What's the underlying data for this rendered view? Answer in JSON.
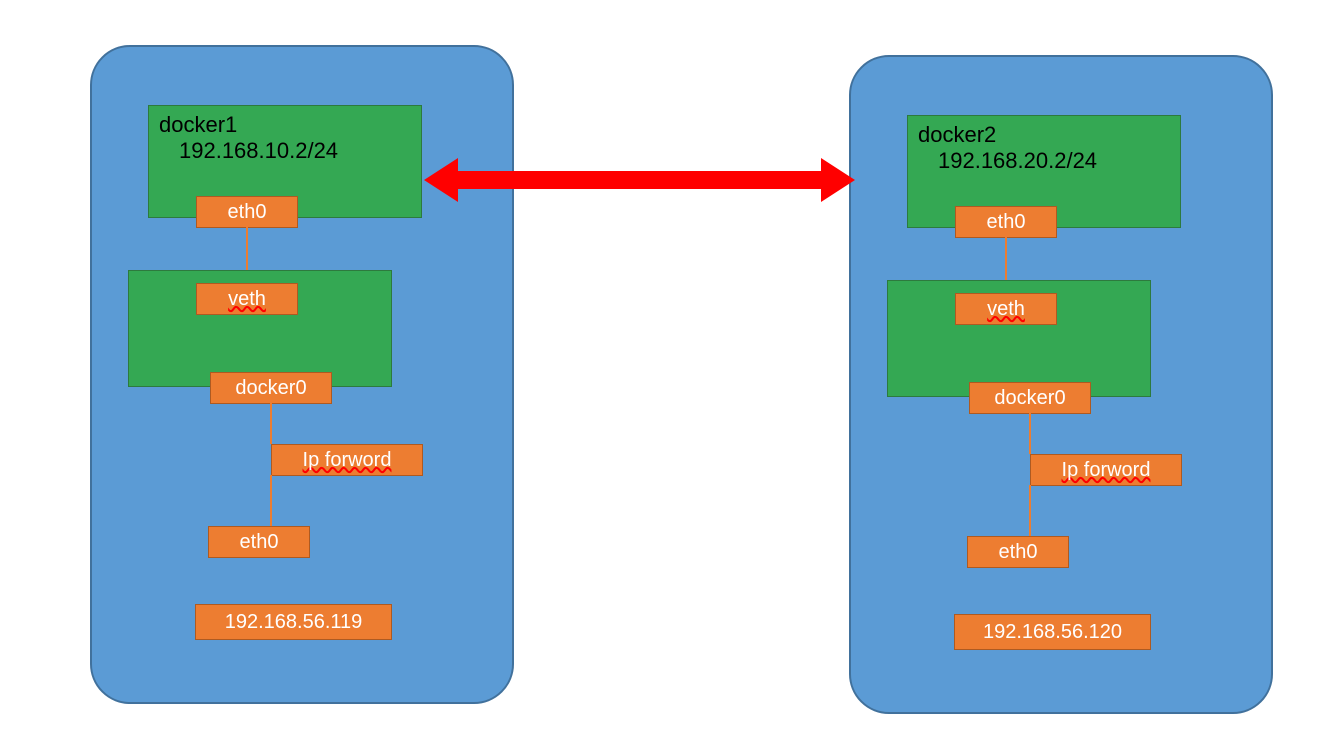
{
  "host1": {
    "docker_name": "docker1",
    "docker_ip": "192.168.10.2/24",
    "eth0_top": "eth0",
    "veth": "veth",
    "docker0": "docker0",
    "ip_forward": "Ip forword",
    "eth0_bottom": "eth0",
    "host_ip": "192.168.56.119"
  },
  "host2": {
    "docker_name": "docker2",
    "docker_ip": "192.168.20.2/24",
    "eth0_top": "eth0",
    "veth": "veth",
    "docker0": "docker0",
    "ip_forward": "Ip forword",
    "eth0_bottom": "eth0",
    "host_ip": "192.168.56.120"
  },
  "colors": {
    "host_box": "#5b9bd5",
    "docker_box": "#34a853",
    "label": "#ed7d31",
    "arrow": "#ff0000"
  }
}
